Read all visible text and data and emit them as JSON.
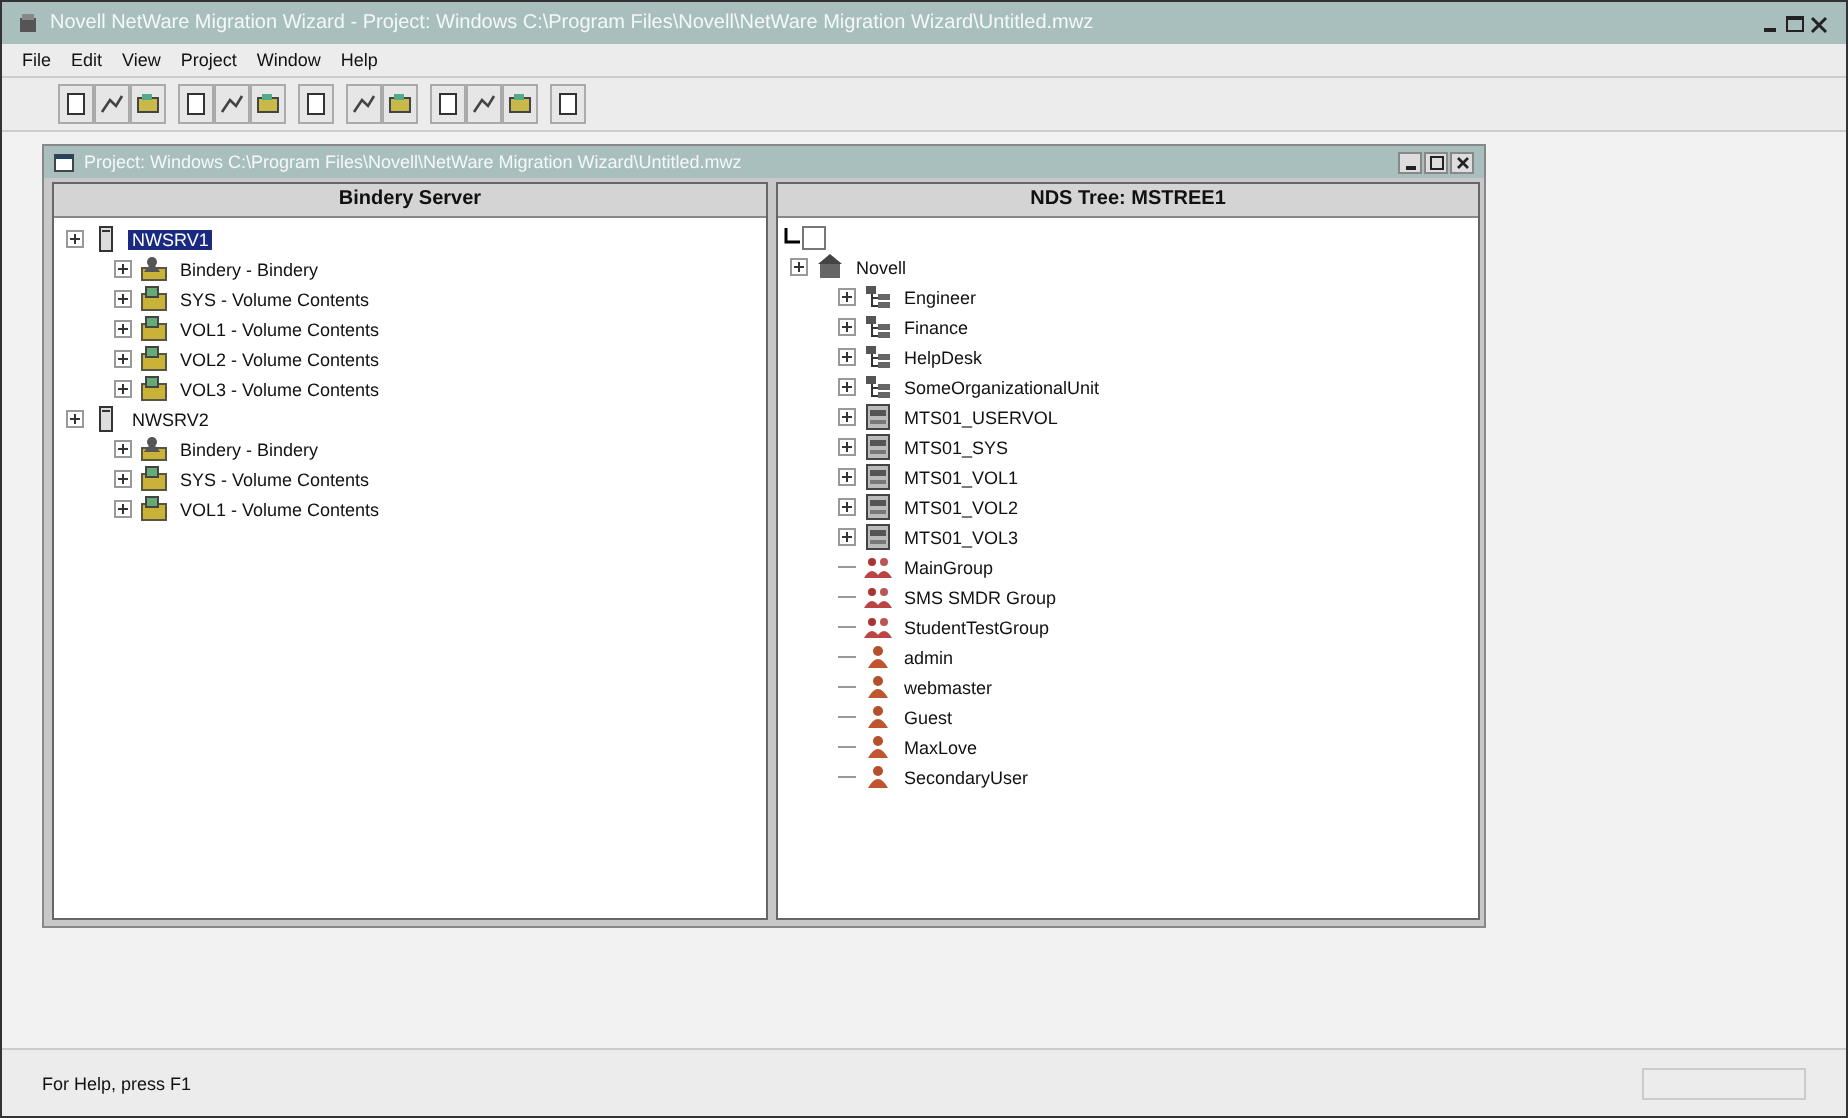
{
  "window": {
    "title": "Novell NetWare Migration Wizard - Project: Windows C:\\Program Files\\Novell\\NetWare Migration Wizard\\Untitled.mwz"
  },
  "menu": [
    "File",
    "Edit",
    "View",
    "Project",
    "Window",
    "Help"
  ],
  "child_window": {
    "title": "Project: Windows C:\\Program Files\\Novell\\NetWare Migration Wizard\\Untitled.mwz"
  },
  "left_pane": {
    "header": "Bindery Server",
    "tree": [
      {
        "label": "NWSRV1",
        "kind": "server",
        "selected": true,
        "children": [
          {
            "label": "Bindery - Bindery",
            "kind": "bindery",
            "selected": false
          },
          {
            "label": "SYS - Volume Contents",
            "kind": "volume",
            "selected": false
          },
          {
            "label": "VOL1 - Volume Contents",
            "kind": "volume",
            "selected": false
          },
          {
            "label": "VOL2 - Volume Contents",
            "kind": "volume",
            "selected": false
          },
          {
            "label": "VOL3 - Volume Contents",
            "kind": "volume",
            "selected": false
          }
        ]
      },
      {
        "label": "NWSRV2",
        "kind": "server",
        "selected": false,
        "children": [
          {
            "label": "Bindery - Bindery",
            "kind": "bindery",
            "selected": false
          },
          {
            "label": "SYS - Volume Contents",
            "kind": "volume",
            "selected": false
          },
          {
            "label": "VOL1 - Volume Contents",
            "kind": "volume",
            "selected": false
          }
        ]
      }
    ]
  },
  "right_pane": {
    "header": "NDS Tree: MSTREE1",
    "tree": [
      {
        "label": "Novell",
        "kind": "organization",
        "selected": false,
        "children": [
          {
            "label": "Engineer",
            "kind": "container",
            "selected": false
          },
          {
            "label": "Finance",
            "kind": "container",
            "selected": false
          },
          {
            "label": "HelpDesk",
            "kind": "container",
            "selected": false
          },
          {
            "label": "SomeOrganizationalUnit",
            "kind": "container",
            "selected": false
          },
          {
            "label": "MTS01_USERVOL",
            "kind": "volume",
            "selected": false
          },
          {
            "label": "MTS01_SYS",
            "kind": "volume",
            "selected": false
          },
          {
            "label": "MTS01_VOL1",
            "kind": "volume",
            "selected": false
          },
          {
            "label": "MTS01_VOL2",
            "kind": "volume",
            "selected": false
          },
          {
            "label": "MTS01_VOL3",
            "kind": "volume",
            "selected": false
          },
          {
            "label": "MainGroup",
            "kind": "group",
            "selected": false
          },
          {
            "label": "SMS SMDR Group",
            "kind": "group",
            "selected": false
          },
          {
            "label": "StudentTestGroup",
            "kind": "group",
            "selected": false
          },
          {
            "label": "admin",
            "kind": "user",
            "selected": false
          },
          {
            "label": "webmaster",
            "kind": "user",
            "selected": false
          },
          {
            "label": "Guest",
            "kind": "user",
            "selected": false
          },
          {
            "label": "MaxLove",
            "kind": "user",
            "selected": false
          },
          {
            "label": "SecondaryUser",
            "kind": "user",
            "selected": false
          }
        ]
      }
    ]
  },
  "status_bar": {
    "text": "For Help, press F1"
  }
}
